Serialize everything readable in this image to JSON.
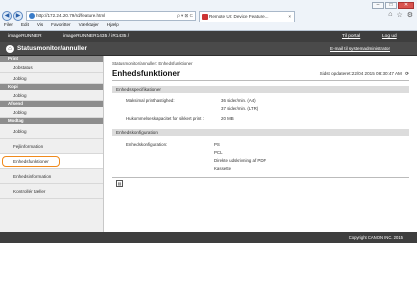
{
  "browser": {
    "url": "http://172.24.20.79/rd/feature.html",
    "url_tools": "ρ ▾ ⊠ C",
    "tab_title": "Remote UI: Device Feature...",
    "menu": [
      "Filer",
      "Edit",
      "Vis",
      "Favoritter",
      "Værktøjer",
      "Hjælp"
    ],
    "window_buttons": [
      "–",
      "□",
      "✕"
    ],
    "icons": [
      "⌂",
      "☆",
      "⚙"
    ]
  },
  "top_bar": {
    "product": "imageRUNNER",
    "device": "imageRUNNER1435 / iR1435 /",
    "portal_link": "Til portal",
    "logout_link": "Log ud"
  },
  "title_bar": {
    "title": "Statusmonitor/annuller",
    "email_link": "E-mail til systemadministrator"
  },
  "sidebar": {
    "sections": [
      {
        "label": "Print",
        "items": [
          "Jobstatus",
          "Joblog"
        ]
      },
      {
        "label": "Kopi",
        "items": [
          "Joblog"
        ]
      },
      {
        "label": "Afsend",
        "items": [
          "Joblog"
        ]
      },
      {
        "label": "Modtag",
        "items": [
          "Joblog"
        ]
      }
    ],
    "device_items": [
      "Fejlinformation",
      "Enhedsfunktioner",
      "Enhedsinformation",
      "Kontrollér tæller"
    ],
    "active_item": "Enhedsfunktioner"
  },
  "main": {
    "breadcrumb": "Statusmonitor/annuller: Enhedsfunktioner",
    "title": "Enhedsfunktioner",
    "updated": "Sidst opdateret:22/04 2015 08:30:47 AM",
    "spec_header": "Enhedsspecifikationer",
    "specs": [
      {
        "label": "Maksimal printhastighed:",
        "value": "36 sider/min. (A4)"
      },
      {
        "label": "",
        "value": "37 sider/min. (LTR)"
      },
      {
        "label": "Hukommelseskapacitet for sikkert print :",
        "value": "20 MB"
      }
    ],
    "config_header": "Enhedskonfiguration",
    "config_label": "Enhedskonfiguration:",
    "config_values": [
      "PS",
      "PCL",
      "Direkte udskrivning af PDF",
      "Kassette"
    ]
  },
  "footer": {
    "copyright": "Copyright CANON INC. 2015"
  },
  "colors": {
    "header_dark": "#3e3e3e",
    "highlight": "#f08a1c",
    "sidebar_section": "#8d8d8d"
  }
}
